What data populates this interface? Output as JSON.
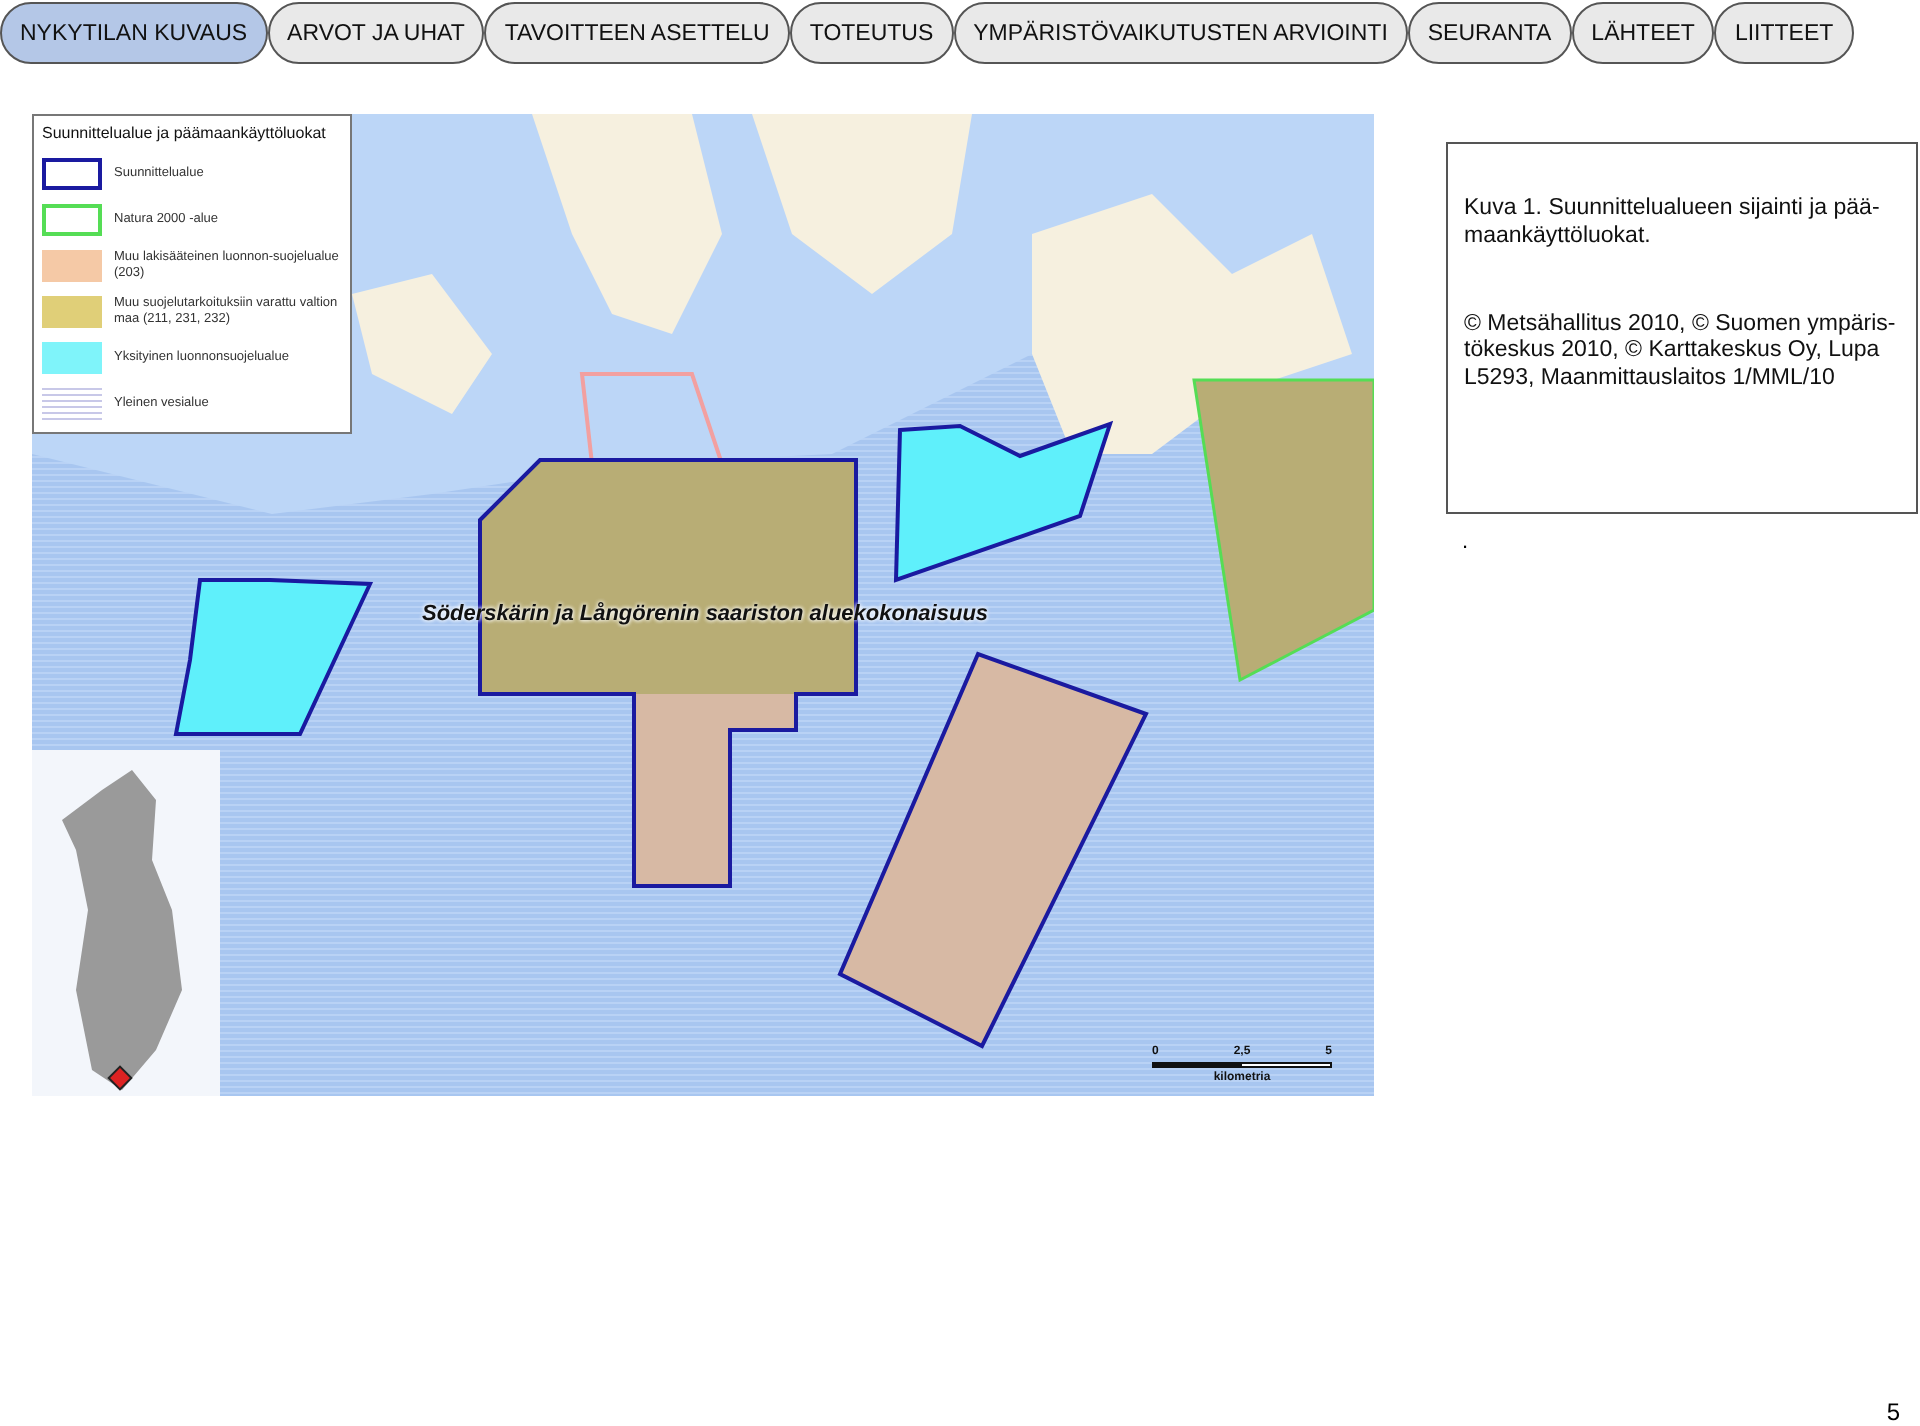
{
  "tabs": [
    {
      "label": "NYKYTILAN KUVAUS",
      "selected": true
    },
    {
      "label": "ARVOT JA UHAT",
      "selected": false
    },
    {
      "label": "TAVOITTEEN ASETTELU",
      "selected": false
    },
    {
      "label": "TOTEUTUS",
      "selected": false
    },
    {
      "label": "YMPÄRISTÖVAIKUTUSTEN ARVIOINTI",
      "selected": false
    },
    {
      "label": "SEURANTA",
      "selected": false
    },
    {
      "label": "LÄHTEET",
      "selected": false
    },
    {
      "label": "LIITTEET",
      "selected": false
    }
  ],
  "map": {
    "title": "Söderskärin ja Långörenin saariston aluekokonaisuus",
    "legend": {
      "title": "Suunnittelualue ja päämaankäyttöluokat",
      "items": [
        {
          "label": "Suunnittelualue",
          "kind": "outline",
          "color": "#1a1aa0"
        },
        {
          "label": "Natura 2000 -alue",
          "kind": "outline",
          "color": "#55dd55"
        },
        {
          "label": "Muu lakisääteinen luonnon-suojelualue (203)",
          "kind": "fill",
          "color": "#f5c9a6"
        },
        {
          "label": "Muu suojelutarkoituksiin varattu valtion maa (211, 231, 232)",
          "kind": "fill",
          "color": "#e0cf78"
        },
        {
          "label": "Yksityinen luonnonsuojelualue",
          "kind": "fill",
          "color": "#7ff4fa"
        },
        {
          "label": "Yleinen vesialue",
          "kind": "hatch",
          "color": "#c8c8e8"
        }
      ]
    },
    "scale": {
      "ticks": [
        "0",
        "2,5",
        "5"
      ],
      "unit": "kilometria"
    }
  },
  "caption": {
    "title": "Kuva 1. Suunnittelualueen sijainti ja pää-maankäyttöluokat.",
    "credits": "© Metsähallitus 2010, © Suomen ympäris-tökeskus 2010, © Karttakeskus Oy, Lupa L5293, Maanmittauslaitos 1/MML/10"
  },
  "note": ".",
  "page_number": "5"
}
